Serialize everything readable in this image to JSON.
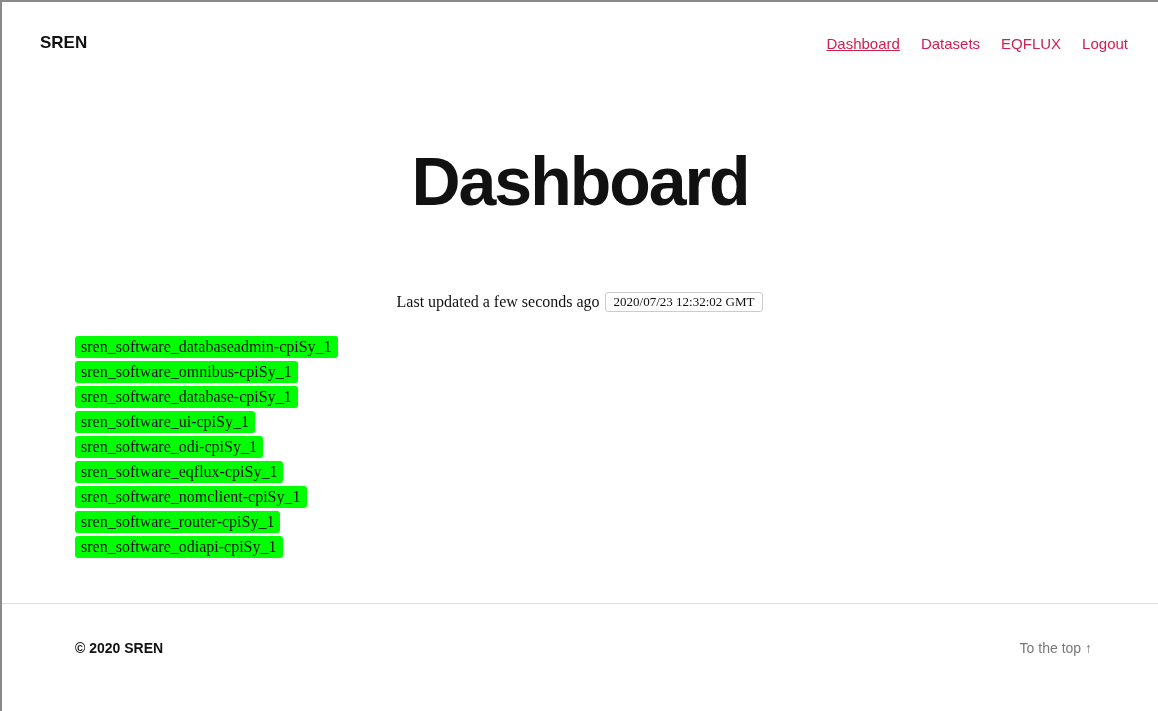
{
  "header": {
    "brand": "SREN",
    "nav": [
      {
        "label": "Dashboard",
        "selected": true
      },
      {
        "label": "Datasets",
        "selected": false
      },
      {
        "label": "EQFLUX",
        "selected": false
      },
      {
        "label": "Logout",
        "selected": false
      }
    ]
  },
  "heading": "Dashboard",
  "updated": {
    "label": "Last updated a few seconds ago",
    "timestamp": "2020/07/23 12:32:02 GMT"
  },
  "containers": [
    {
      "name": "sren_software_databaseadmin-cpiSy_1",
      "color": "#00ff00"
    },
    {
      "name": "sren_software_omnibus-cpiSy_1",
      "color": "#00ff00"
    },
    {
      "name": "sren_software_database-cpiSy_1",
      "color": "#00ff00"
    },
    {
      "name": "sren_software_ui-cpiSy_1",
      "color": "#00ff00"
    },
    {
      "name": "sren_software_odi-cpiSy_1",
      "color": "#00ff00"
    },
    {
      "name": "sren_software_eqflux-cpiSy_1",
      "color": "#00ff00"
    },
    {
      "name": "sren_software_nomclient-cpiSy_1",
      "color": "#00ff00"
    },
    {
      "name": "sren_software_router-cpiSy_1",
      "color": "#00ff00"
    },
    {
      "name": "sren_software_odiapi-cpiSy_1",
      "color": "#00ff00"
    }
  ],
  "footer": {
    "copyright": "© 2020 SREN",
    "top_link": "To the top ↑"
  }
}
